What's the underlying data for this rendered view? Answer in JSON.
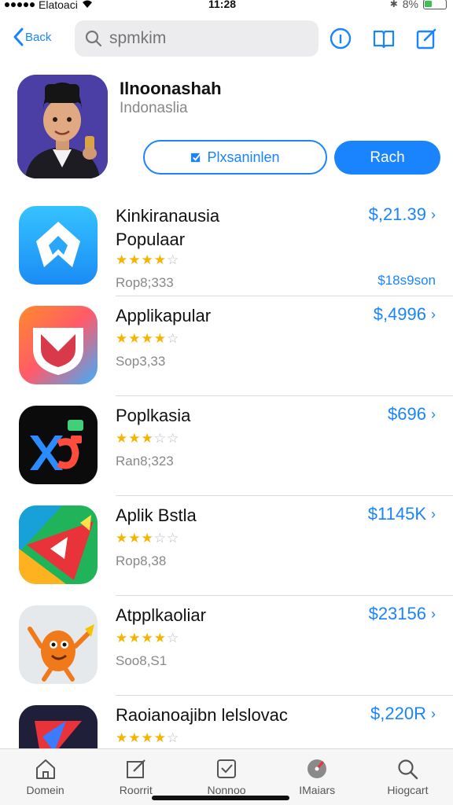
{
  "status": {
    "carrier": "Elatoaci",
    "time": "11:28",
    "battery_pct": "8%"
  },
  "nav": {
    "back_label": "Back",
    "search_placeholder": "spmkim"
  },
  "featured": {
    "title": "Ilnoonashah",
    "subtitle": "Indonaslia",
    "secondary_button": "Plxsaninlen",
    "primary_button": "Rach"
  },
  "apps": [
    {
      "name": "Kinkiranausia\nPopulaar",
      "stars": 4,
      "meta": "Rop8;333",
      "price": "$,21.39",
      "sub": "$18s9son"
    },
    {
      "name": "Applikapular",
      "stars": 4,
      "meta": "Sop3,33",
      "price": "$,4996",
      "sub": ""
    },
    {
      "name": "Poplkasia",
      "stars": 3,
      "meta": "Ran8;323",
      "price": "$696",
      "sub": ""
    },
    {
      "name": "Aplik Bstla",
      "stars": 3,
      "meta": "Rop8,38",
      "price": "$1145K",
      "sub": ""
    },
    {
      "name": "Atpplkaoliar",
      "stars": 4,
      "meta": "Soo8,S1",
      "price": "$23156",
      "sub": ""
    },
    {
      "name": "Raoianoajibn lelslovac",
      "stars": 4,
      "meta": "",
      "price": "$,220R",
      "sub": ""
    }
  ],
  "tabs": [
    {
      "label": "Domein",
      "icon": "home-icon"
    },
    {
      "label": "Roorrit",
      "icon": "edit-icon"
    },
    {
      "label": "Nonnoo",
      "icon": "card-icon"
    },
    {
      "label": "IMaiars",
      "icon": "gauge-icon"
    },
    {
      "label": "Hiogcart",
      "icon": "search-icon"
    }
  ],
  "colors": {
    "accent": "#1a84ff",
    "star": "#f5b400"
  }
}
